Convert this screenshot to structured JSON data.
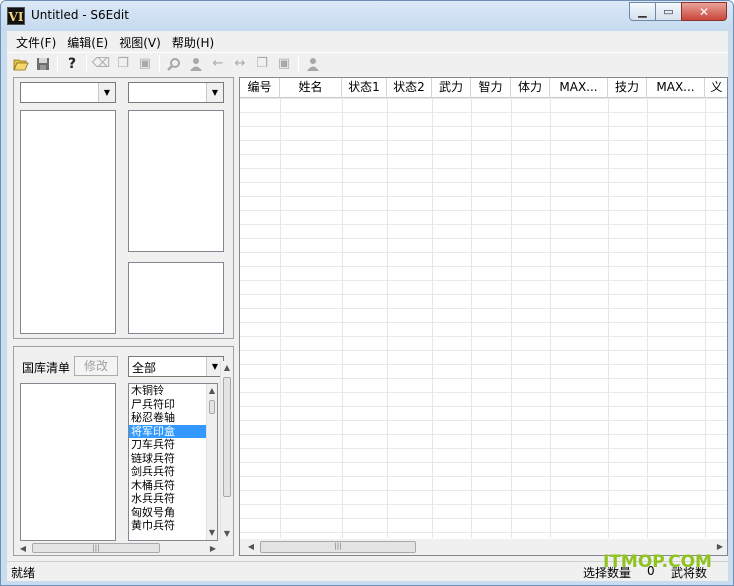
{
  "window": {
    "title": "Untitled - S6Edit",
    "app_icon_text": "VI"
  },
  "menu": [
    "文件(F)",
    "编辑(E)",
    "视图(V)",
    "帮助(H)"
  ],
  "toolbar": {
    "icons": [
      "open-icon",
      "save-icon",
      "help-icon",
      "eraser-icon",
      "copy-icon",
      "paste-icon",
      "search-icon",
      "person-icon",
      "arrow-left-icon",
      "swap-icon",
      "copy-icon",
      "paste-icon",
      "person-icon"
    ]
  },
  "left_top": {
    "combo1_value": "",
    "combo2_value": ""
  },
  "treasury": {
    "label": "国库清单",
    "edit_button": "修改",
    "filter_value": "全部",
    "items": [
      "木铜铃",
      "尸兵符印",
      "秘忍卷轴",
      "将军印盒",
      "刀车兵符",
      "链球兵符",
      "剑兵兵符",
      "木桶兵符",
      "水兵兵符",
      "匈奴号角",
      "黄巾兵符"
    ],
    "selected_index": 3
  },
  "grid": {
    "columns": [
      "编号",
      "姓名",
      "状态1",
      "状态2",
      "武力",
      "智力",
      "体力",
      "MAX...",
      "技力",
      "MAX...",
      "义"
    ]
  },
  "status": {
    "left": "就绪",
    "select_count_label": "选择数量",
    "select_count_value": "0",
    "general_count_label": "武将数"
  },
  "watermark": "ITMOP.COM",
  "colors": {
    "selection": "#3399ff",
    "title_gradient": "#c5d9ef",
    "close_button": "#c9453a",
    "watermark": "#8fc31f"
  }
}
